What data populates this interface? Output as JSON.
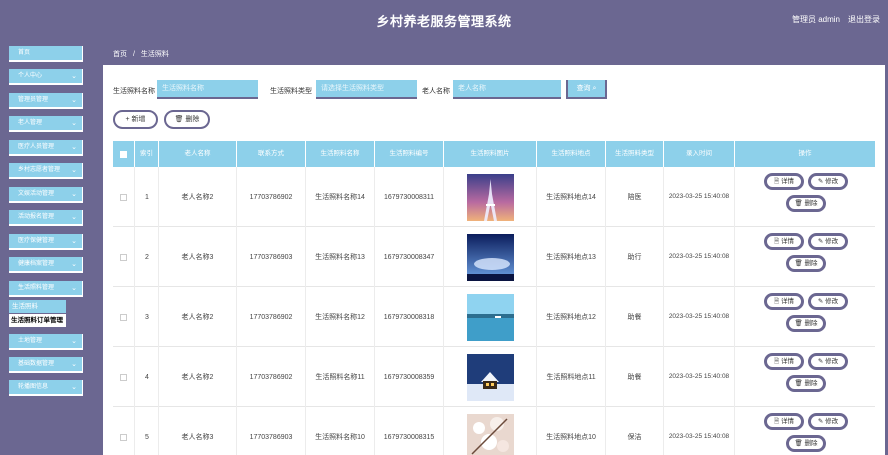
{
  "header": {
    "title": "乡村养老服务管理系统",
    "user": "管理员 admin",
    "logout": "退出登录"
  },
  "sidebar": {
    "items": [
      {
        "label": "首页",
        "chev": ""
      },
      {
        "label": "个人中心",
        "chev": "⌄"
      },
      {
        "label": "管理员管理",
        "chev": "⌄"
      },
      {
        "label": "老人管理",
        "chev": "⌄"
      },
      {
        "label": "医疗人员管理",
        "chev": "⌄"
      },
      {
        "label": "乡村志愿者管理",
        "chev": "⌄"
      },
      {
        "label": "文娱活动管理",
        "chev": "⌄"
      },
      {
        "label": "活动报名管理",
        "chev": "⌄"
      },
      {
        "label": "医疗保健管理",
        "chev": "⌄"
      },
      {
        "label": "健康档案管理",
        "chev": "⌄"
      },
      {
        "label": "生活照料管理",
        "chev": "⌄"
      },
      {
        "label": "生活照料",
        "chev": ""
      },
      {
        "label": "生活照料订单管理",
        "chev": ""
      },
      {
        "label": "土地管理",
        "chev": "⌄"
      },
      {
        "label": "基础数据管理",
        "chev": "⌄"
      },
      {
        "label": "轮播图信息",
        "chev": "⌄"
      }
    ]
  },
  "breadcrumb": {
    "home": "首页",
    "sep": "/",
    "current": "生活照料"
  },
  "search": {
    "name_label": "生活照料名称",
    "name_placeholder": "生活照料名称",
    "type_label": "生活照料类型",
    "type_placeholder": "请选择生活照料类型",
    "elder_label": "老人名称",
    "elder_placeholder": "老人名称",
    "button": "查询 ⌕"
  },
  "actions": {
    "add": "+ 新增",
    "delete": "🗑 删除"
  },
  "table": {
    "headers": [
      "",
      "索引",
      "老人名称",
      "联系方式",
      "生活照料名称",
      "生活照料编号",
      "生活照料图片",
      "生活照料地点",
      "生活照料类型",
      "录入时间",
      "操作"
    ],
    "ops": {
      "detail": "🗎 详情",
      "edit": "✎ 修改",
      "delete": "🗑 删除"
    },
    "rows": [
      {
        "index": "1",
        "elder": "老人名称2",
        "phone": "17703786902",
        "name": "生活照料名称14",
        "code": "1679730008311",
        "place": "生活照料地点14",
        "type": "陪医",
        "time": "2023-03-25 15:40:08",
        "image": "eiffel-tower-photo"
      },
      {
        "index": "2",
        "elder": "老人名称3",
        "phone": "17703786903",
        "name": "生活照料名称13",
        "code": "1679730008347",
        "place": "生活照料地点13",
        "type": "助行",
        "time": "2023-03-25 15:40:08",
        "image": "night-sky-photo"
      },
      {
        "index": "3",
        "elder": "老人名称2",
        "phone": "17703786902",
        "name": "生活照料名称12",
        "code": "1679730008318",
        "place": "生活照料地点12",
        "type": "助餐",
        "time": "2023-03-25 15:40:08",
        "image": "lake-photo"
      },
      {
        "index": "4",
        "elder": "老人名称2",
        "phone": "17703786902",
        "name": "生活照料名称11",
        "code": "1679730008359",
        "place": "生活照料地点11",
        "type": "助餐",
        "time": "2023-03-25 15:40:08",
        "image": "snow-house-photo"
      },
      {
        "index": "5",
        "elder": "老人名称3",
        "phone": "17703786903",
        "name": "生活照料名称10",
        "code": "1679730008315",
        "place": "生活照料地点10",
        "type": "保洁",
        "time": "2023-03-25 15:40:08",
        "image": "blossom-photo"
      }
    ]
  },
  "colors": {
    "primary": "#6b6791",
    "accent": "#8dd0ea"
  }
}
